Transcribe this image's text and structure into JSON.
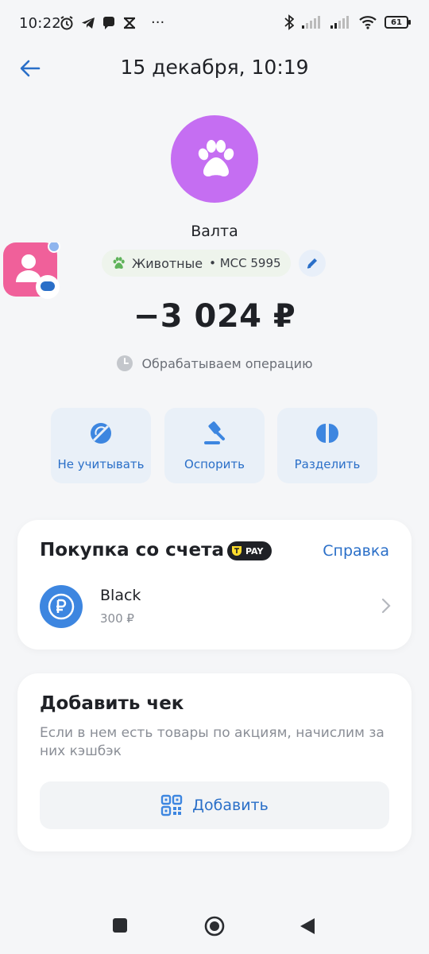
{
  "status_bar": {
    "time": "10:22",
    "more": "···",
    "battery": "61"
  },
  "header": {
    "title": "15 декабря, 10:19"
  },
  "merchant": {
    "name": "Валта",
    "avatar_color": "#c56ef2",
    "category": "Животные",
    "mcc": "• MCC 5995"
  },
  "transaction": {
    "amount": "−3 024 ₽",
    "status": "Обрабатываем операцию"
  },
  "actions": [
    {
      "label": "Не учитывать",
      "icon": "eye-off-icon"
    },
    {
      "label": "Оспорить",
      "icon": "gavel-icon"
    },
    {
      "label": "Разделить",
      "icon": "split-icon"
    }
  ],
  "purchase_card": {
    "title": "Покупка со счета",
    "badge": "PAY",
    "help": "Справка",
    "account": {
      "name": "Black",
      "balance": "300 ₽"
    }
  },
  "receipt_card": {
    "title": "Добавить чек",
    "description": "Если в нем есть товары по акциям, начислим за них кэшбэк",
    "button": "Добавить"
  },
  "colors": {
    "accent": "#2a6fc8",
    "background": "#f5f6f8",
    "tile": "#e9f0f8"
  }
}
